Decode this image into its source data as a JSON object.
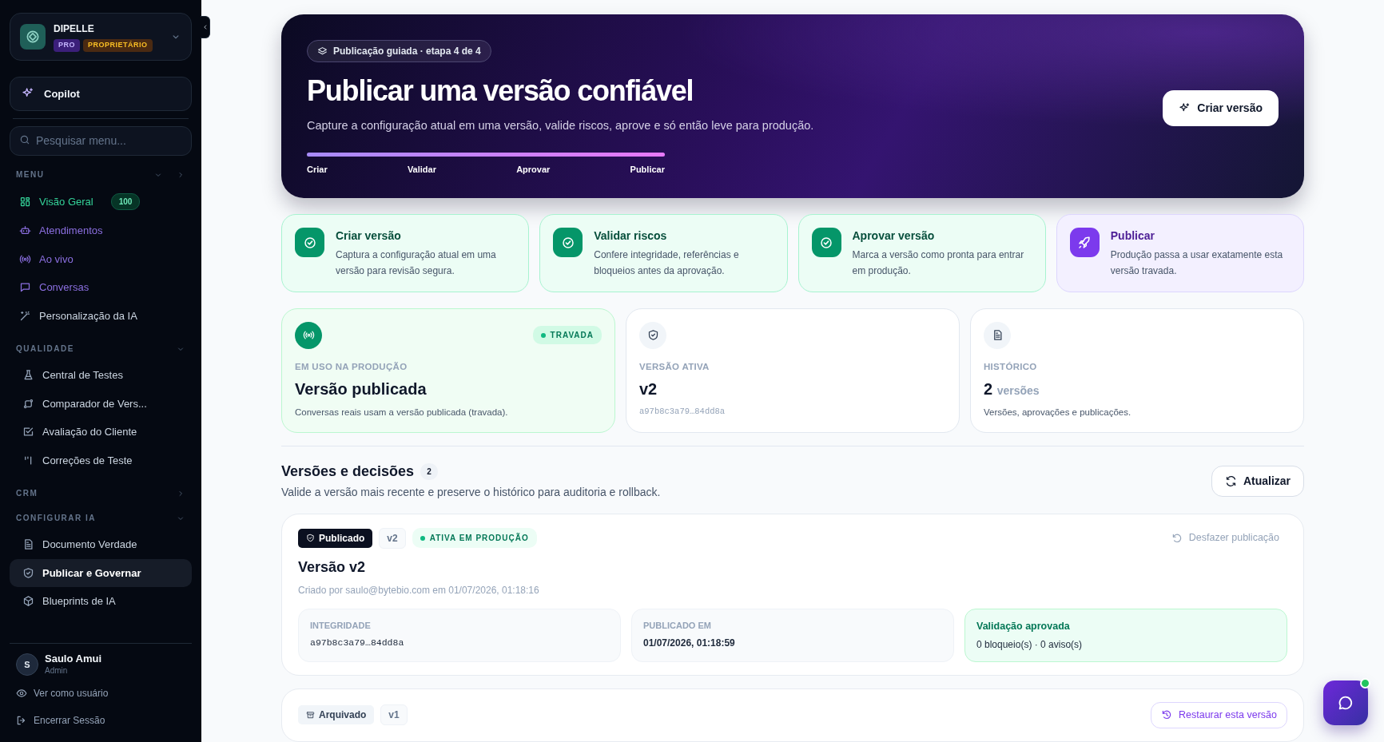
{
  "sidebar": {
    "org": {
      "name": "DIPELLE",
      "badges": [
        {
          "label": "PRO",
          "kind": "plan"
        },
        {
          "label": "PROPRIETÁRIO",
          "kind": "role"
        }
      ]
    },
    "copilot": {
      "label": "Copilot"
    },
    "search": {
      "placeholder": "Pesquisar menu..."
    },
    "sections": [
      {
        "label": "MENU",
        "expanded": true,
        "has_next": true,
        "items": [
          {
            "label": "Visão Geral",
            "color": "#34d399",
            "badge": "100",
            "selected": false
          },
          {
            "label": "Atendimentos",
            "color": "#8b6fe0",
            "selected": false
          },
          {
            "label": "Ao vivo",
            "color": "#8b6fe0",
            "selected": false
          },
          {
            "label": "Conversas",
            "color": "#8b6fe0",
            "selected": false
          },
          {
            "label": "Personalização da IA",
            "selected": false
          }
        ]
      },
      {
        "label": "QUALIDADE",
        "expanded": true,
        "items": [
          {
            "label": "Central de Testes",
            "selected": false
          },
          {
            "label": "Comparador de Vers...",
            "selected": false
          },
          {
            "label": "Avaliação do Cliente",
            "selected": false
          },
          {
            "label": "Correções de Teste",
            "selected": false
          }
        ]
      },
      {
        "label": "CRM",
        "expanded": false
      },
      {
        "label": "CONFIGURAR IA",
        "expanded": true,
        "items": [
          {
            "label": "Documento Verdade",
            "selected": false
          },
          {
            "label": "Publicar e Governar",
            "selected": true
          },
          {
            "label": "Blueprints de IA",
            "selected": false
          }
        ]
      }
    ],
    "user": {
      "initial": "S",
      "name": "Saulo Amui",
      "role": "Admin"
    },
    "footer_links": [
      {
        "label": "Ver como usuário"
      },
      {
        "label": "Encerrar Sessão"
      }
    ]
  },
  "hero": {
    "chip": "Publicação guiada · etapa 4 de 4",
    "title": "Publicar uma versão confiável",
    "subtitle": "Capture a configuração atual em uma versão, valide riscos, aprove e só então leve para produção.",
    "progress": {
      "level": 1,
      "labels": [
        "Criar",
        "Validar",
        "Aprovar",
        "Publicar"
      ]
    },
    "button": "Criar versão"
  },
  "steps": [
    {
      "title": "Criar versão",
      "description": "Captura a configuração atual em uma versão para revisão segura.",
      "done": true
    },
    {
      "title": "Validar riscos",
      "description": "Confere integridade, referências e bloqueios antes da aprovação.",
      "done": true
    },
    {
      "title": "Aprovar versão",
      "description": "Marca a versão como pronta para entrar em produção.",
      "done": true
    },
    {
      "title": "Publicar",
      "description": "Produção passa a usar exatamente esta versão travada.",
      "done": false
    }
  ],
  "stats": [
    {
      "kind": "production",
      "label": "EM USO NA PRODUÇÃO",
      "value": "Versão publicada",
      "note": "Conversas reais usam a versão publicada (travada).",
      "badge": "TRAVADA"
    },
    {
      "kind": "active",
      "label": "VERSÃO ATIVA",
      "value": "v2",
      "hash": "a97b8c3a79…84dd8a"
    },
    {
      "kind": "history",
      "label": "HISTÓRICO",
      "value": "2",
      "unit": "versões",
      "note": "Versões, aprovações e publicações."
    }
  ],
  "versions_section": {
    "title": "Versões e decisões",
    "count": "2",
    "subtitle": "Valide a versão mais recente e preserve o histórico para auditoria e rollback.",
    "refresh_button": "Atualizar"
  },
  "versions": [
    {
      "status": {
        "label": "Publicado",
        "kind": "published"
      },
      "tag": "v2",
      "live_badge": "ATIVA EM PRODUÇÃO",
      "action": {
        "label": "Desfazer publicação",
        "kind": "undo"
      },
      "title": "Versão v2",
      "meta": "Criado por saulo@bytebio.com em 01/07/2026, 01:18:16",
      "fields": [
        {
          "label": "INTEGRIDADE",
          "value": "a97b8c3a79…84dd8a",
          "kind": "hash"
        },
        {
          "label": "PUBLICADO EM",
          "value": "01/07/2026, 01:18:59",
          "kind": "date"
        }
      ],
      "validation": {
        "title": "Validação aprovada",
        "detail": "0 bloqueio(s) · 0 aviso(s)"
      }
    },
    {
      "status": {
        "label": "Arquivado",
        "kind": "archived"
      },
      "tag": "v1",
      "action": {
        "label": "Restaurar esta versão",
        "kind": "restore"
      }
    }
  ],
  "chat_button": {
    "online": true
  }
}
